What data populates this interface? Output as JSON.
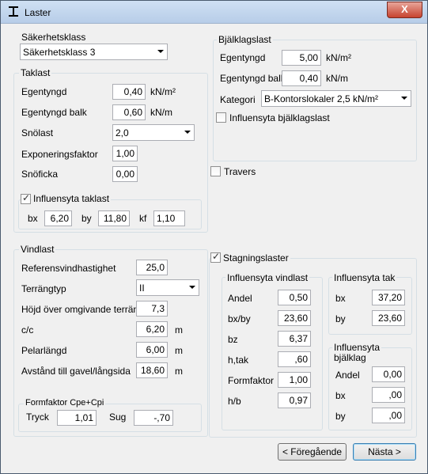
{
  "window": {
    "title": "Laster",
    "close_label": "X"
  },
  "sakerhet": {
    "group": "Säkerhetsklass",
    "value": "Säkerhetsklass 3"
  },
  "taklast": {
    "group": "Taklast",
    "egentyngd": {
      "label": "Egentyngd",
      "value": "0,40",
      "unit": "kN/m²"
    },
    "egentyngd_balk": {
      "label": "Egentyngd balk",
      "value": "0,60",
      "unit": "kN/m"
    },
    "snolast": {
      "label": "Snölast",
      "value": "2,0"
    },
    "exponering": {
      "label": "Exponeringsfaktor",
      "value": "1,00"
    },
    "snoficka": {
      "label": "Snöficka",
      "value": "0,00"
    },
    "influens": {
      "label": "Influensyta taklast",
      "checked": true,
      "bx_label": "bx",
      "bx": "6,20",
      "by_label": "by",
      "by": "11,80",
      "kf_label": "kf",
      "kf": "1,10"
    }
  },
  "bjalklag": {
    "group": "Bjälklagslast",
    "egentyngd": {
      "label": "Egentyngd",
      "value": "5,00",
      "unit": "kN/m²"
    },
    "egentyngd_balk": {
      "label": "Egentyngd balk",
      "value": "0,40",
      "unit": "kN/m"
    },
    "kategori": {
      "label": "Kategori",
      "value": "B-Kontorslokaler 2,5 kN/m²"
    },
    "influens": {
      "label": "Influensyta bjälklagslast",
      "checked": false
    }
  },
  "travers": {
    "label": "Travers",
    "checked": false
  },
  "vindlast": {
    "group": "Vindlast",
    "referens": {
      "label": "Referensvindhastighet",
      "value": "25,0"
    },
    "terrang": {
      "label": "Terrängtyp",
      "value": "II"
    },
    "hojd": {
      "label": "Höjd över omgivande terräng",
      "value": "7,3"
    },
    "cc": {
      "label": "c/c",
      "value": "6,20",
      "unit": "m"
    },
    "pelar": {
      "label": "Pelarlängd",
      "value": "6,00",
      "unit": "m"
    },
    "avstand": {
      "label": "Avstånd till gavel/långsida",
      "value": "18,60",
      "unit": "m"
    },
    "formfaktor": {
      "group": "Formfaktor Cpe+Cpi",
      "tryck_label": "Tryck",
      "tryck": "1,01",
      "sug_label": "Sug",
      "sug": "-,70"
    }
  },
  "stagning": {
    "label": "Stagningslaster",
    "checked": true,
    "vind": {
      "group": "Influensyta vindlast",
      "andel": {
        "label": "Andel",
        "value": "0,50"
      },
      "bxby": {
        "label": "bx/by",
        "value": "23,60"
      },
      "bz": {
        "label": "bz",
        "value": "6,37"
      },
      "htak": {
        "label": "h,tak",
        "value": ",60"
      },
      "form": {
        "label": "Formfaktor",
        "value": "1,00"
      },
      "hb": {
        "label": "h/b",
        "value": "0,97"
      }
    },
    "tak": {
      "group": "Influensyta tak",
      "bx": {
        "label": "bx",
        "value": "37,20"
      },
      "by": {
        "label": "by",
        "value": "23,60"
      }
    },
    "bjalk": {
      "group_line1": "Influensyta",
      "group_line2": "bjälklag",
      "andel": {
        "label": "Andel",
        "value": "0,00"
      },
      "bx": {
        "label": "bx",
        "value": ",00"
      },
      "by": {
        "label": "by",
        "value": ",00"
      }
    }
  },
  "buttons": {
    "prev": "< Föregående",
    "next": "Nästa >"
  }
}
